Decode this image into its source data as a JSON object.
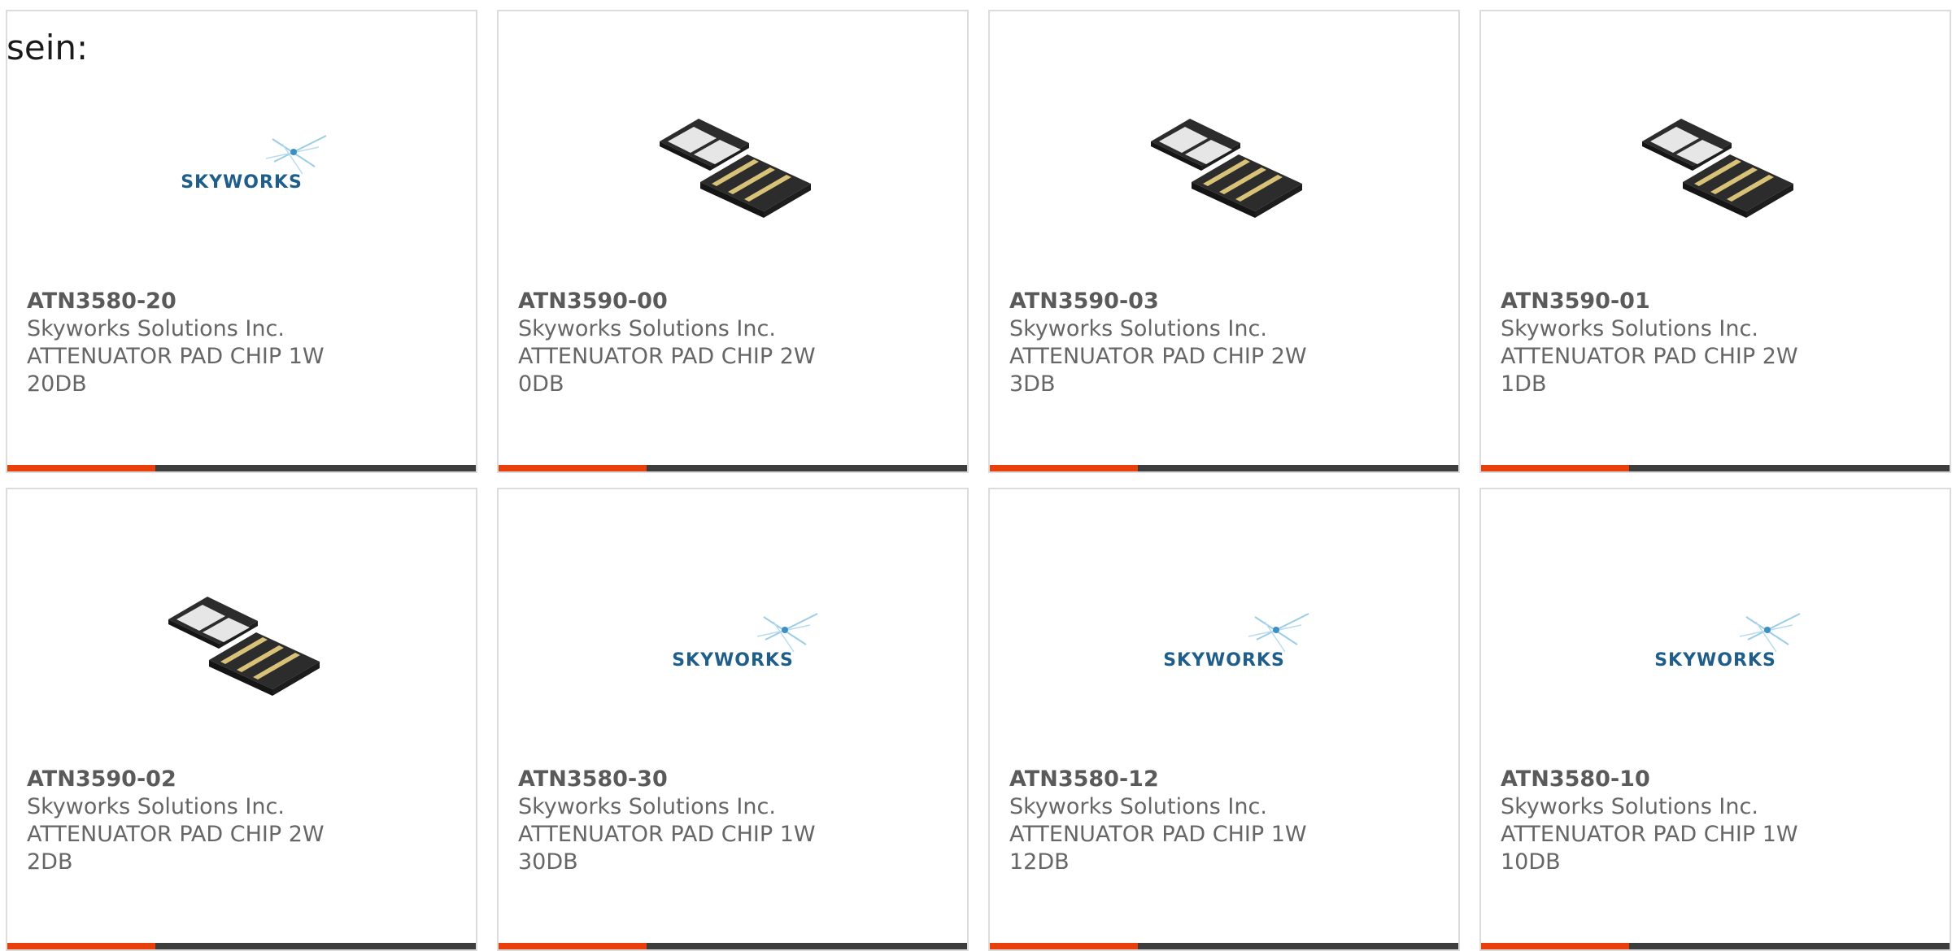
{
  "page": {
    "lead_text": "sein:",
    "accent_color": "#e8400c",
    "bar_color": "#3d3d3d",
    "brand_color": "#1f5e8a"
  },
  "products": [
    {
      "part": "ATN3580-20",
      "maker": "Skyworks Solutions Inc.",
      "desc_1": "ATTENUATOR PAD CHIP 1W",
      "desc_2": "20DB",
      "image": "skyworks-logo"
    },
    {
      "part": "ATN3590-00",
      "maker": "Skyworks Solutions Inc.",
      "desc_1": "ATTENUATOR PAD CHIP 2W 0DB",
      "desc_2": "",
      "image": "chip-photo"
    },
    {
      "part": "ATN3590-03",
      "maker": "Skyworks Solutions Inc.",
      "desc_1": "ATTENUATOR PAD CHIP 2W 3DB",
      "desc_2": "",
      "image": "chip-photo"
    },
    {
      "part": "ATN3590-01",
      "maker": "Skyworks Solutions Inc.",
      "desc_1": "ATTENUATOR PAD CHIP 2W 1DB",
      "desc_2": "",
      "image": "chip-photo"
    },
    {
      "part": "ATN3590-02",
      "maker": "Skyworks Solutions Inc.",
      "desc_1": "ATTENUATOR PAD CHIP 2W 2DB",
      "desc_2": "",
      "image": "chip-photo"
    },
    {
      "part": "ATN3580-30",
      "maker": "Skyworks Solutions Inc.",
      "desc_1": "ATTENUATOR PAD CHIP 1W",
      "desc_2": "30DB",
      "image": "skyworks-logo"
    },
    {
      "part": "ATN3580-12",
      "maker": "Skyworks Solutions Inc.",
      "desc_1": "ATTENUATOR PAD CHIP 1W",
      "desc_2": "12DB",
      "image": "skyworks-logo"
    },
    {
      "part": "ATN3580-10",
      "maker": "Skyworks Solutions Inc.",
      "desc_1": "ATTENUATOR PAD CHIP 1W",
      "desc_2": "10DB",
      "image": "skyworks-logo"
    }
  ],
  "logo": {
    "wordmark": "SKYWORKS"
  }
}
